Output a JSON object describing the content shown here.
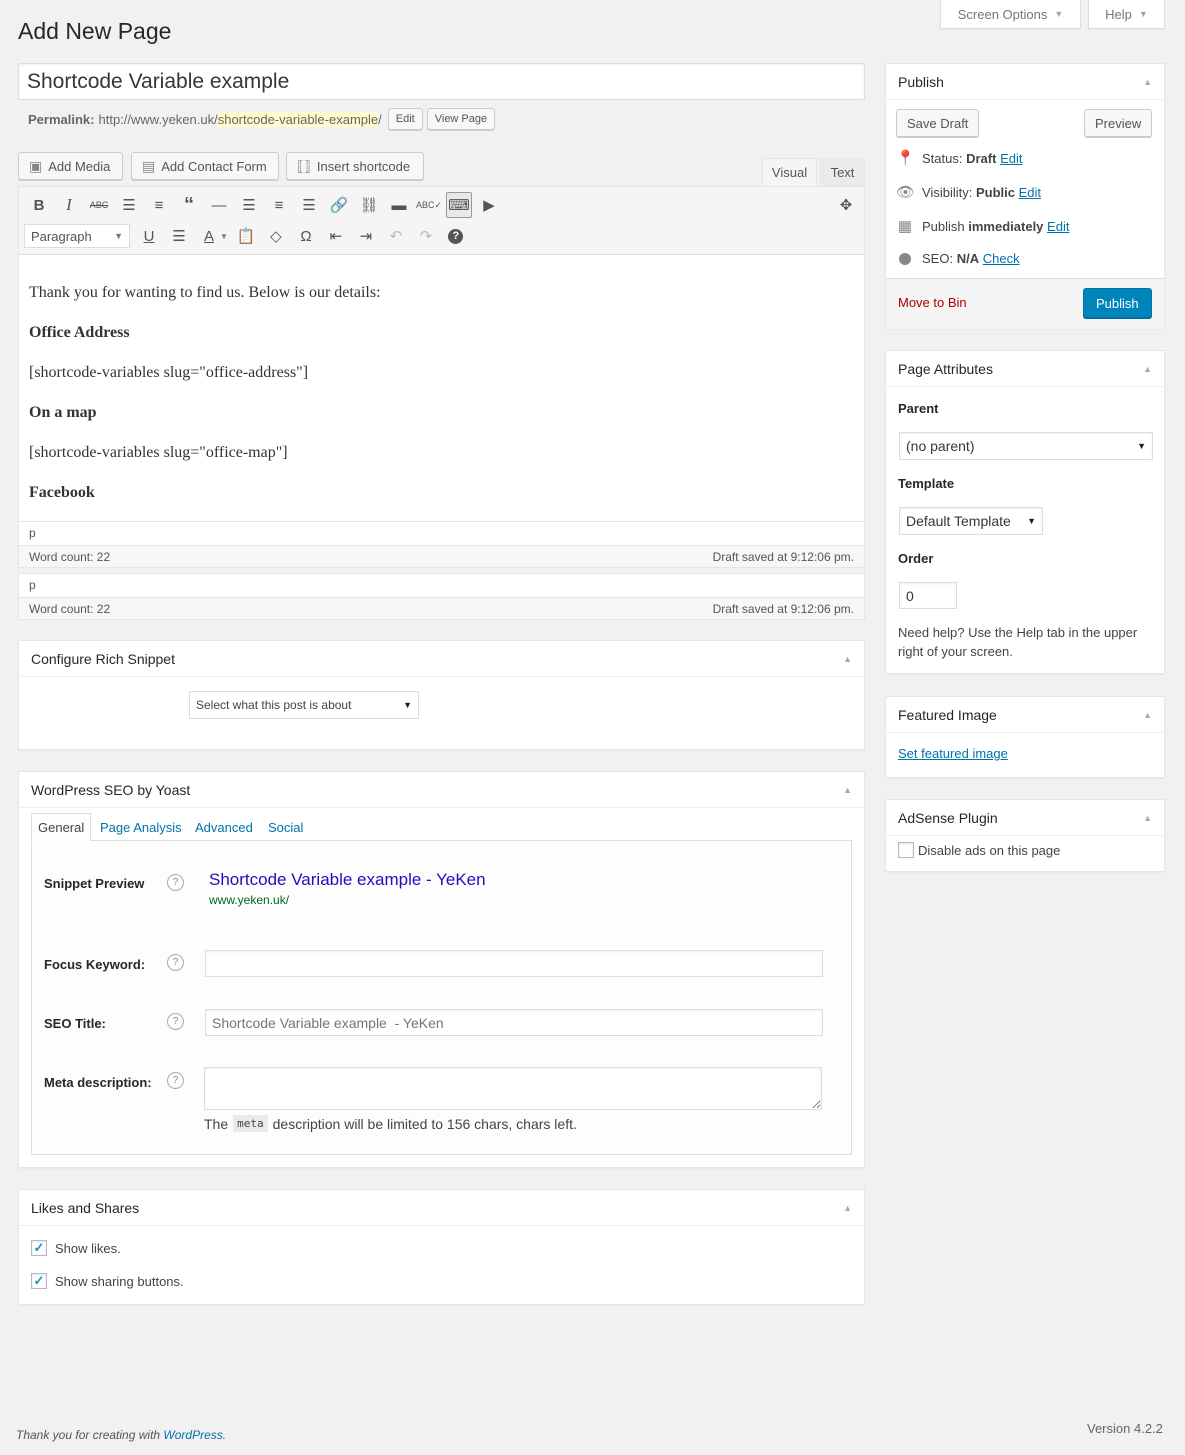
{
  "screen_meta": {
    "screen_options": "Screen Options",
    "help": "Help"
  },
  "page_title": "Add New Page",
  "post_title": "Shortcode Variable example",
  "permalink": {
    "label": "Permalink:",
    "base": "http://www.yeken.uk/",
    "slug": "shortcode-variable-example",
    "suffix": "/",
    "edit_label": "Edit",
    "view_label": "View Page"
  },
  "media_buttons": [
    {
      "label": "Add Media",
      "icon": "media-icon"
    },
    {
      "label": "Add Contact Form",
      "icon": "form-icon"
    },
    {
      "label": "Insert shortcode",
      "icon": "shortcode-icon"
    }
  ],
  "editor": {
    "tabs": [
      {
        "label": "Visual",
        "active": true
      },
      {
        "label": "Text",
        "active": false
      }
    ],
    "format_select": "Paragraph",
    "toolbar_row1": [
      "bold",
      "italic",
      "strikethrough",
      "bullet-list",
      "numbered-list",
      "blockquote",
      "horizontal-line",
      "align-left",
      "align-center",
      "align-right",
      "insert-link",
      "remove-link",
      "read-more",
      "spellcheck",
      "toolbar-toggle",
      "insert-media-embed"
    ],
    "toolbar_row2": [
      "underline",
      "justify",
      "text-color",
      "paste-as-text",
      "clear-formatting",
      "special-character",
      "outdent",
      "indent",
      "undo",
      "redo",
      "keyboard-shortcuts"
    ],
    "content": [
      {
        "type": "p",
        "text": "Thank you for wanting to find us. Below is our details:"
      },
      {
        "type": "h",
        "text": "Office Address"
      },
      {
        "type": "p",
        "text": "[shortcode-variables slug=\"office-address\"]"
      },
      {
        "type": "h",
        "text": "On a map"
      },
      {
        "type": "p",
        "text": "[shortcode-variables slug=\"office-map\"]"
      },
      {
        "type": "h",
        "text": "Facebook"
      }
    ],
    "path": "p",
    "word_count": "Word count: 22",
    "draft_saved": "Draft saved at 9:12:06 pm."
  },
  "rich_snippet": {
    "title": "Configure Rich Snippet",
    "select": "Select what this post is about"
  },
  "yoast": {
    "title": "WordPress SEO by Yoast",
    "tabs": [
      "General",
      "Page Analysis",
      "Advanced",
      "Social"
    ],
    "snippet_label": "Snippet Preview",
    "snippet_title": "Shortcode Variable example - YeKen",
    "snippet_url": "www.yeken.uk/",
    "focus_label": "Focus Keyword:",
    "focus_value": "",
    "seo_title_label": "SEO Title:",
    "seo_title_placeholder": "Shortcode Variable example  - YeKen",
    "meta_label": "Meta description:",
    "meta_note_pre": "The",
    "meta_note_code": "meta",
    "meta_note_post": "description will be limited to 156 chars, chars left."
  },
  "likes": {
    "title": "Likes and Shares",
    "options": [
      {
        "label": "Show likes.",
        "checked": true
      },
      {
        "label": "Show sharing buttons.",
        "checked": true
      }
    ]
  },
  "publish": {
    "title": "Publish",
    "save_draft": "Save Draft",
    "preview": "Preview",
    "status_label": "Status:",
    "status_value": "Draft",
    "visibility_label": "Visibility:",
    "visibility_value": "Public",
    "publish_label": "Publish",
    "publish_value": "immediately",
    "seo_label": "SEO:",
    "seo_value": "N/A",
    "edit": "Edit",
    "check": "Check",
    "move_to_bin": "Move to Bin",
    "publish_button": "Publish"
  },
  "page_attributes": {
    "title": "Page Attributes",
    "parent_label": "Parent",
    "parent_value": "(no parent)",
    "template_label": "Template",
    "template_value": "Default Template",
    "order_label": "Order",
    "order_value": "0",
    "help_text": "Need help? Use the Help tab in the upper right of your screen."
  },
  "featured_image": {
    "title": "Featured Image",
    "link": "Set featured image"
  },
  "adsense": {
    "title": "AdSense Plugin",
    "option": "Disable ads on this page",
    "checked": false
  },
  "footer": {
    "thanks_pre": "Thank you for creating with",
    "thanks_link": "WordPress",
    "thanks_post": ".",
    "version": "Version 4.2.2"
  },
  "colors": {
    "primary": "#0085ba",
    "link": "#0073aa",
    "delete": "#a00",
    "snippet_title": "#1e0fbe",
    "snippet_url": "#006621"
  }
}
